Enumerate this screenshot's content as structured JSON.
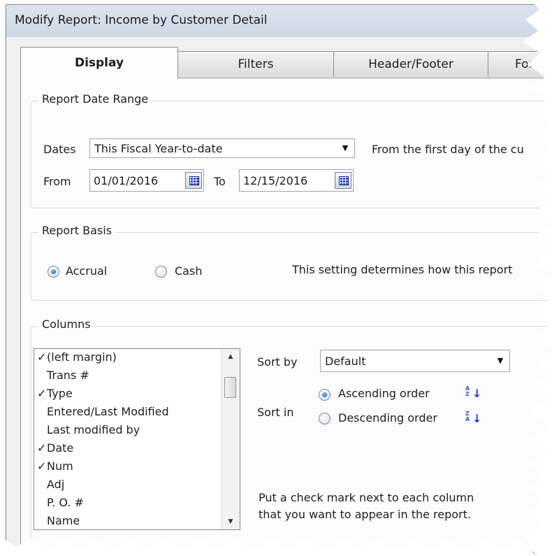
{
  "window": {
    "title": "Modify Report: Income by Customer Detail"
  },
  "tabs": [
    {
      "label": "Display",
      "active": true
    },
    {
      "label": "Filters",
      "active": false
    },
    {
      "label": "Header/Footer",
      "active": false
    },
    {
      "label": "Fonts",
      "active": false
    }
  ],
  "date_range": {
    "group_title": "Report Date Range",
    "dates_label": "Dates",
    "dates_value": "This Fiscal Year-to-date",
    "description": "From the first day of the cu",
    "from_label": "From",
    "from_value": "01/01/2016",
    "to_label": "To",
    "to_value": "12/15/2016"
  },
  "report_basis": {
    "group_title": "Report Basis",
    "accrual_label": "Accrual",
    "cash_label": "Cash",
    "selected": "Accrual",
    "description": "This setting determines how this report"
  },
  "columns": {
    "group_title": "Columns",
    "items": [
      {
        "label": "(left margin)",
        "checked": true
      },
      {
        "label": "Trans #",
        "checked": false
      },
      {
        "label": "Type",
        "checked": true
      },
      {
        "label": "Entered/Last Modified",
        "checked": false
      },
      {
        "label": "Last modified by",
        "checked": false
      },
      {
        "label": "Date",
        "checked": true
      },
      {
        "label": "Num",
        "checked": true
      },
      {
        "label": "Adj",
        "checked": false
      },
      {
        "label": "P. O. #",
        "checked": false
      },
      {
        "label": "Name",
        "checked": false
      }
    ],
    "check_glyph": "✓",
    "sort_by_label": "Sort by",
    "sort_by_value": "Default",
    "sort_in_label": "Sort in",
    "ascending_label": "Ascending order",
    "descending_label": "Descending order",
    "sort_selected": "Ascending order",
    "hint_line1": "Put a check mark next to each column",
    "hint_line2": "that you want to appear in the report."
  },
  "colors": {
    "title_bar": "#d5dee9",
    "tab_body": "#fcfcfc",
    "calendar_blue": "#2a44b8",
    "radio_selected": "#1b59b8"
  },
  "icons": {
    "calendar": "calendar-icon",
    "dropdown": "chevron-down-icon",
    "sort_ascending": "sort-az-icon",
    "sort_descending": "sort-za-icon"
  }
}
